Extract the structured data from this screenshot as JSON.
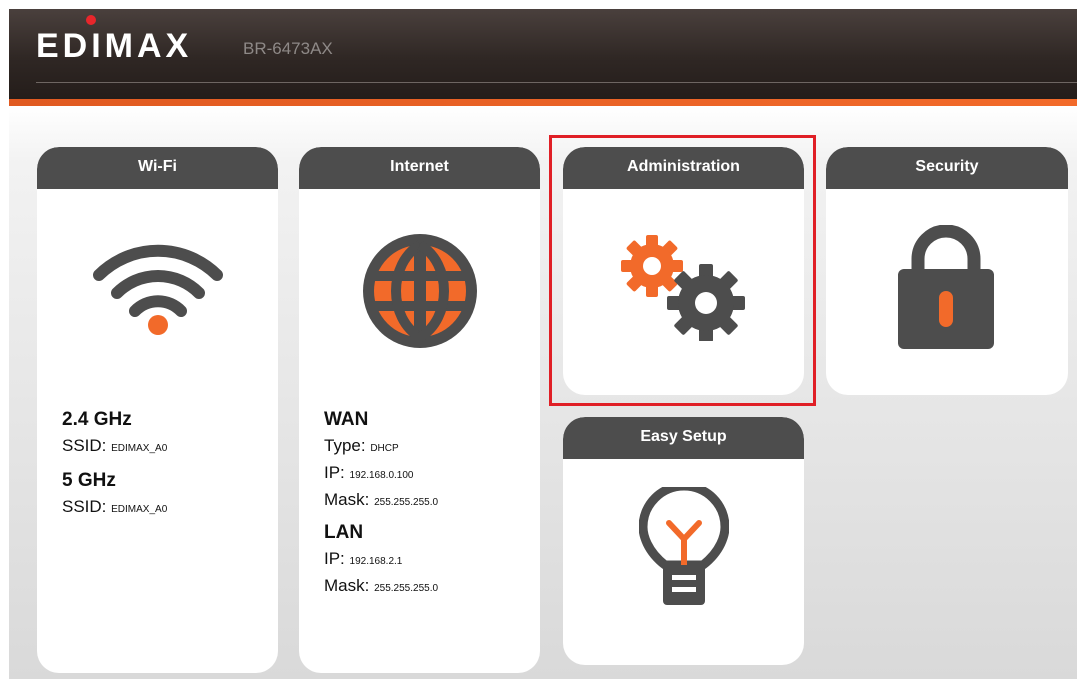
{
  "header": {
    "brand": "EDIMAX",
    "model": "BR-6473AX"
  },
  "colors": {
    "accent": "#f26a2a",
    "dark": "#4d4d4d",
    "highlight": "#e01f26"
  },
  "cards": {
    "wifi": {
      "title": "Wi-Fi",
      "icon": "wifi-icon",
      "band1": "2.4 GHz",
      "band1_ssid_label": "SSID:",
      "band1_ssid": "EDIMAX_A0",
      "band2": "5 GHz",
      "band2_ssid_label": "SSID:",
      "band2_ssid": "EDIMAX_A0"
    },
    "internet": {
      "title": "Internet",
      "icon": "globe-icon",
      "wan_title": "WAN",
      "wan_type_label": "Type:",
      "wan_type": "DHCP",
      "wan_ip_label": "IP:",
      "wan_ip": "192.168.0.100",
      "wan_mask_label": "Mask:",
      "wan_mask": "255.255.255.0",
      "lan_title": "LAN",
      "lan_ip_label": "IP:",
      "lan_ip": "192.168.2.1",
      "lan_mask_label": "Mask:",
      "lan_mask": "255.255.255.0"
    },
    "administration": {
      "title": "Administration",
      "icon": "gears-icon"
    },
    "security": {
      "title": "Security",
      "icon": "lock-icon"
    },
    "easy_setup": {
      "title": "Easy Setup",
      "icon": "lightbulb-icon"
    }
  }
}
